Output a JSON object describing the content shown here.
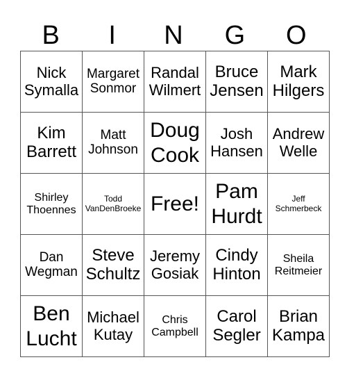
{
  "title_letters": [
    "B",
    "I",
    "N",
    "G",
    "O"
  ],
  "rows": [
    [
      {
        "line1": "Nick",
        "line2": "Symalla",
        "size": "lg"
      },
      {
        "line1": "Margaret",
        "line2": "Sonmor",
        "size": "md"
      },
      {
        "line1": "Randal",
        "line2": "Wilmert",
        "size": "lg"
      },
      {
        "line1": "Bruce",
        "line2": "Jensen",
        "size": "xl"
      },
      {
        "line1": "Mark",
        "line2": "Hilgers",
        "size": "xl"
      }
    ],
    [
      {
        "line1": "Kim",
        "line2": "Barrett",
        "size": "xl"
      },
      {
        "line1": "Matt",
        "line2": "Johnson",
        "size": "md"
      },
      {
        "line1": "Doug",
        "line2": "Cook",
        "size": "xxl"
      },
      {
        "line1": "Josh",
        "line2": "Hansen",
        "size": "lg"
      },
      {
        "line1": "Andrew",
        "line2": "Welle",
        "size": "lg"
      }
    ],
    [
      {
        "line1": "Shirley",
        "line2": "Thoennes",
        "size": "sm"
      },
      {
        "line1": "Todd",
        "line2": "VanDenBroeke",
        "size": "xs"
      },
      {
        "line1": "Free!",
        "line2": "",
        "size": "xxl",
        "free": true
      },
      {
        "line1": "Pam",
        "line2": "Hurdt",
        "size": "xxl"
      },
      {
        "line1": "Jeff",
        "line2": "Schmerbeck",
        "size": "xs"
      }
    ],
    [
      {
        "line1": "Dan",
        "line2": "Wegman",
        "size": "md"
      },
      {
        "line1": "Steve",
        "line2": "Schultz",
        "size": "xl"
      },
      {
        "line1": "Jeremy",
        "line2": "Gosiak",
        "size": "lg"
      },
      {
        "line1": "Cindy",
        "line2": "Hinton",
        "size": "xl"
      },
      {
        "line1": "Sheila",
        "line2": "Reitmeier",
        "size": "sm"
      }
    ],
    [
      {
        "line1": "Ben",
        "line2": "Lucht",
        "size": "xxl"
      },
      {
        "line1": "Michael",
        "line2": "Kutay",
        "size": "lg"
      },
      {
        "line1": "Chris",
        "line2": "Campbell",
        "size": "sm"
      },
      {
        "line1": "Carol",
        "line2": "Segler",
        "size": "xl"
      },
      {
        "line1": "Brian",
        "line2": "Kampa",
        "size": "xl"
      }
    ]
  ]
}
